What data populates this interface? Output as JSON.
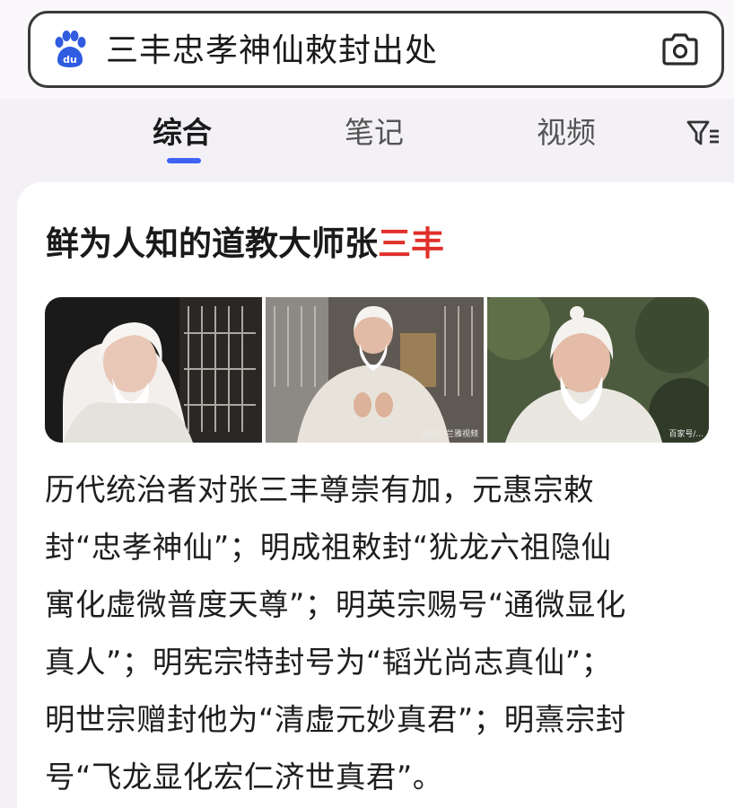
{
  "search": {
    "query": "三丰忠孝神仙敕封出处"
  },
  "icons": {
    "logo": "baidu-paw-logo",
    "camera": "camera-icon",
    "filter": "filter-icon"
  },
  "tabs": [
    {
      "label": "综合",
      "active": true
    },
    {
      "label": "笔记",
      "active": false
    },
    {
      "label": "视频",
      "active": false
    }
  ],
  "result": {
    "title_prefix": "鲜为人知的道教大师张",
    "title_highlight": "三丰",
    "images": [
      {
        "alt": "white-haired taoist master portrait",
        "watermark": ""
      },
      {
        "alt": "taoist master seated with hands raised",
        "watermark": "百家号/兰雅视频"
      },
      {
        "alt": "taoist master close-up outdoors",
        "watermark": "百家号/..."
      }
    ],
    "lines": [
      "历代统治者对张三丰尊崇有加，元惠宗敕",
      "封“忠孝神仙”；明成祖敕封“犹龙六祖隐仙",
      "寓化虚微普度天尊”；明英宗赐号“通微显化",
      "真人”；明宪宗特封号为“韬光尚志真仙”；",
      "明世宗赠封他为“清虚元妙真君”；明熹宗封",
      "号“飞龙显化宏仁济世真君”。"
    ]
  },
  "colors": {
    "accent": "#3e62f2",
    "highlight": "#e0302a",
    "logo_blue": "#2f5ce0"
  }
}
